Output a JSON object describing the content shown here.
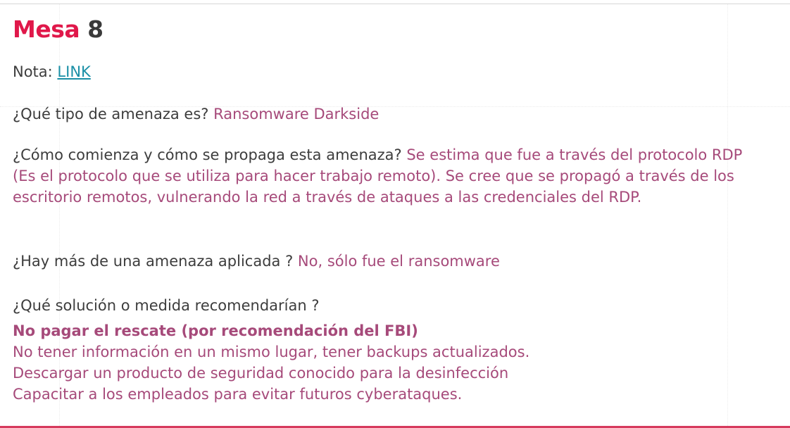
{
  "title": {
    "part1": "Mesa",
    "part2": "8"
  },
  "nota": {
    "label": "Nota: ",
    "link": "LINK"
  },
  "q1": {
    "question": "¿Qué tipo de amenaza es? ",
    "answer": "Ransomware Darkside"
  },
  "q2": {
    "question": "¿Cómo comienza y cómo se propaga esta amenaza? ",
    "answer": "Se estima que fue a través del protocolo RDP (Es el protocolo que se utiliza para hacer trabajo remoto). Se cree que se propagó a través de los escritorio remotos, vulnerando la red a través de ataques a las credenciales del RDP."
  },
  "q3": {
    "question": "¿Hay más de una amenaza aplicada ? ",
    "answer": "No, sólo fue el ransomware"
  },
  "q4": {
    "question": "¿Qué solución o medida recomendarían ?",
    "answers": [
      "No pagar el rescate (por recomendación del FBI)",
      "No tener información en un mismo lugar, tener backups actualizados.",
      "Descargar un producto de seguridad conocido para la desinfección",
      "Capacitar a los empleados para evitar futuros cyberataques."
    ]
  },
  "colors": {
    "title_accent": "#e0184a",
    "answer": "#a64a7a",
    "link": "#1a8fa6",
    "bottom_border": "#d63a5d"
  }
}
